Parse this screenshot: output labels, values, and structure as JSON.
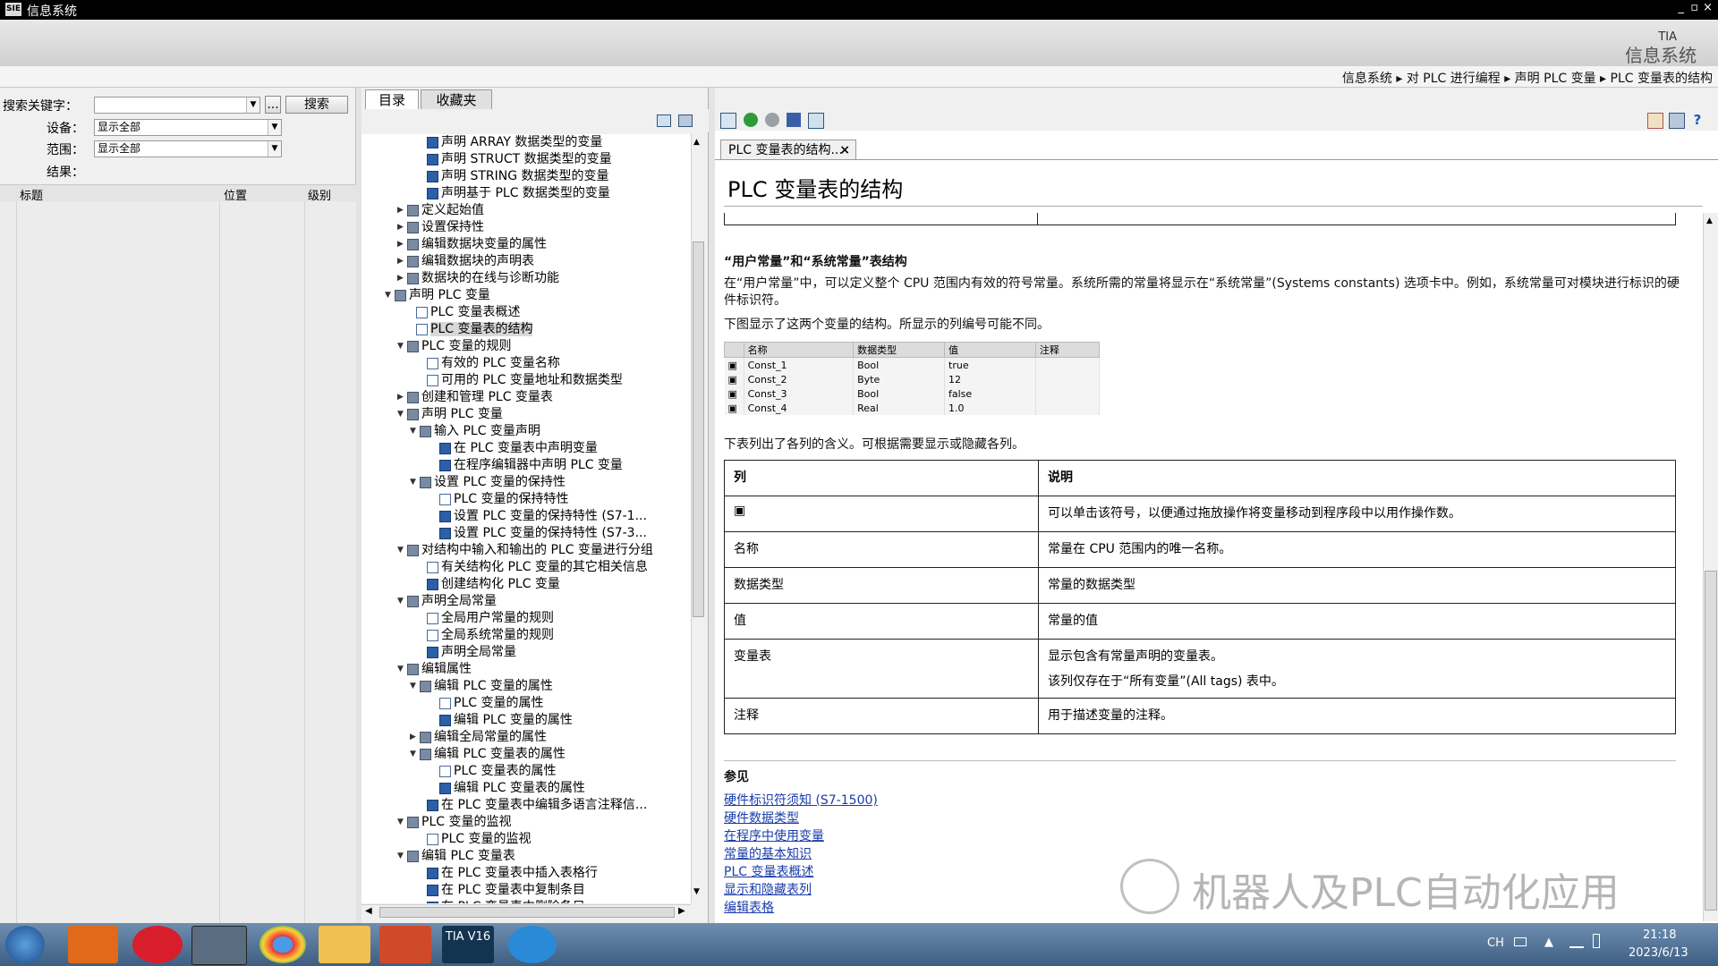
{
  "window": {
    "title": "信息系统",
    "controls": [
      "_",
      "▫",
      "×"
    ]
  },
  "brand": {
    "tia": "TIA",
    "name": "信息系统"
  },
  "breadcrumb": "信息系统 ▸ 对 PLC 进行编程 ▸ 声明 PLC 变量 ▸ PLC 变量表的结构",
  "search": {
    "keyword_label": "搜索关键字：",
    "keyword_value": "",
    "more_label": "...",
    "search_button": "搜索",
    "device_label": "设备：",
    "device_value": "显示全部",
    "scope_label": "范围：",
    "scope_value": "显示全部",
    "results_label": "结果：",
    "columns": [
      "标题",
      "位置",
      "级别"
    ]
  },
  "toc": {
    "tabs": [
      "目录",
      "收藏夹"
    ],
    "nodes": [
      {
        "t": "声明 ARRAY 数据类型的变量",
        "i": "topic",
        "e": ""
      },
      {
        "t": "声明 STRUCT 数据类型的变量",
        "i": "topic",
        "e": ""
      },
      {
        "t": "声明 STRING 数据类型的变量",
        "i": "topic",
        "e": ""
      },
      {
        "t": "声明基于 PLC 数据类型的变量",
        "i": "topic",
        "e": ""
      },
      {
        "t": "定义起始值",
        "i": "book",
        "e": "▶"
      },
      {
        "t": "设置保持性",
        "i": "book",
        "e": "▶"
      },
      {
        "t": "编辑数据块变量的属性",
        "i": "book",
        "e": "▶"
      },
      {
        "t": "编辑数据块的声明表",
        "i": "book",
        "e": "▶"
      },
      {
        "t": "数据块的在线与诊断功能",
        "i": "book",
        "e": "▶"
      },
      {
        "t": "声明 PLC 变量",
        "i": "book",
        "e": "▼"
      },
      {
        "t": "PLC 变量表概述",
        "i": "page",
        "e": ""
      },
      {
        "t": "PLC 变量表的结构",
        "i": "page",
        "e": "",
        "sel": true
      },
      {
        "t": "PLC 变量的规则",
        "i": "book",
        "e": "▼"
      },
      {
        "t": "有效的 PLC 变量名称",
        "i": "page",
        "e": ""
      },
      {
        "t": "可用的 PLC 变量地址和数据类型",
        "i": "page",
        "e": ""
      },
      {
        "t": "创建和管理 PLC 变量表",
        "i": "book",
        "e": "▶"
      },
      {
        "t": "声明 PLC 变量",
        "i": "book",
        "e": "▼"
      },
      {
        "t": "输入 PLC 变量声明",
        "i": "book",
        "e": "▼"
      },
      {
        "t": "在 PLC 变量表中声明变量",
        "i": "topic",
        "e": ""
      },
      {
        "t": "在程序编辑器中声明 PLC 变量",
        "i": "topic",
        "e": ""
      },
      {
        "t": "设置 PLC 变量的保持性",
        "i": "book",
        "e": "▼"
      },
      {
        "t": "PLC 变量的保持特性",
        "i": "page",
        "e": ""
      },
      {
        "t": "设置 PLC 变量的保持特性 (S7-1...",
        "i": "topic",
        "e": ""
      },
      {
        "t": "设置 PLC 变量的保持特性 (S7-3...",
        "i": "topic",
        "e": ""
      },
      {
        "t": "对结构中输入和输出的 PLC 变量进行分组",
        "i": "book",
        "e": "▼"
      },
      {
        "t": "有关结构化 PLC 变量的其它相关信息",
        "i": "page",
        "e": ""
      },
      {
        "t": "创建结构化 PLC 变量",
        "i": "topic",
        "e": ""
      },
      {
        "t": "声明全局常量",
        "i": "book",
        "e": "▼"
      },
      {
        "t": "全局用户常量的规则",
        "i": "page",
        "e": ""
      },
      {
        "t": "全局系统常量的规则",
        "i": "page",
        "e": ""
      },
      {
        "t": "声明全局常量",
        "i": "topic",
        "e": ""
      },
      {
        "t": "编辑属性",
        "i": "book",
        "e": "▼"
      },
      {
        "t": "编辑 PLC 变量的属性",
        "i": "book",
        "e": "▼"
      },
      {
        "t": "PLC 变量的属性",
        "i": "page",
        "e": ""
      },
      {
        "t": "编辑 PLC 变量的属性",
        "i": "topic",
        "e": ""
      },
      {
        "t": "编辑全局常量的属性",
        "i": "book",
        "e": "▶"
      },
      {
        "t": "编辑 PLC 变量表的属性",
        "i": "book",
        "e": "▼"
      },
      {
        "t": "PLC 变量表的属性",
        "i": "page",
        "e": ""
      },
      {
        "t": "编辑 PLC 变量表的属性",
        "i": "topic",
        "e": ""
      },
      {
        "t": "在 PLC 变量表中编辑多语言注释信...",
        "i": "topic",
        "e": ""
      },
      {
        "t": "PLC 变量的监视",
        "i": "book",
        "e": "▼"
      },
      {
        "t": "PLC 变量的监视",
        "i": "page",
        "e": ""
      },
      {
        "t": "编辑 PLC 变量表",
        "i": "book",
        "e": "▼"
      },
      {
        "t": "在 PLC 变量表中插入表格行",
        "i": "topic",
        "e": ""
      },
      {
        "t": "在 PLC 变量表中复制条目",
        "i": "topic",
        "e": ""
      },
      {
        "t": "在 PLC 变量表中删除条目",
        "i": "topic",
        "e": ""
      }
    ]
  },
  "content": {
    "tab_label": "PLC 变量表的结构...",
    "tab_close": "×",
    "title": "PLC 变量表的结构",
    "section_heading": "“用户常量”和“系统常量”表结构",
    "para1": "在“用户常量”中，可以定义整个 CPU 范围内有效的符号常量。系统所需的常量将显示在“系统常量”(Systems constants) 选项卡中。例如，系统常量可对模块进行标识的硬件标识符。",
    "para2": "下图显示了这两个变量的结构。所显示的列编号可能不同。",
    "var_table": {
      "headers": [
        "",
        "名称",
        "数据类型",
        "值",
        "注释"
      ],
      "rows": [
        [
          "Const_1",
          "Bool",
          "true",
          ""
        ],
        [
          "Const_2",
          "Byte",
          "12",
          ""
        ],
        [
          "Const_3",
          "Bool",
          "false",
          ""
        ],
        [
          "Const_4",
          "Real",
          "1.0",
          ""
        ]
      ]
    },
    "para3": "下表列出了各列的含义。可根据需要显示或隐藏各列。",
    "desc_table": {
      "headers": [
        "列",
        "说明"
      ],
      "rows": [
        [
          "▣",
          "可以单击该符号，以便通过拖放操作将变量移动到程序段中以用作操作数。",
          ""
        ],
        [
          "名称",
          "常量在 CPU 范围内的唯一名称。",
          ""
        ],
        [
          "数据类型",
          "常量的数据类型",
          ""
        ],
        [
          "值",
          "常量的值",
          ""
        ],
        [
          "变量表",
          "显示包含有常量声明的变量表。",
          "该列仅存在于“所有变量”(All tags) 表中。"
        ],
        [
          "注释",
          "用于描述变量的注释。",
          ""
        ]
      ]
    },
    "see_also": "参见",
    "links": [
      "硬件标识符须知 (S7-1500)",
      "硬件数据类型",
      "在程序中使用变量",
      "常量的基本知识",
      "PLC 变量表概述",
      "显示和隐藏表列",
      "编辑表格"
    ]
  },
  "watermark": "机器人及PLC自动化应用",
  "taskbar": {
    "lang": "CH",
    "time": "21:18",
    "date": "2023/6/13",
    "apps": [
      "start-button",
      "media-app",
      "music-app",
      "tool-app",
      "chrome-app",
      "explorer-app",
      "presentation-app",
      "tia-portal-app",
      "browser-app"
    ],
    "tia_label": "TIA V16"
  },
  "colors": {
    "accent_link": "#1a3caa",
    "taskbar": "#3e5e82",
    "titlebar": "#000000"
  }
}
